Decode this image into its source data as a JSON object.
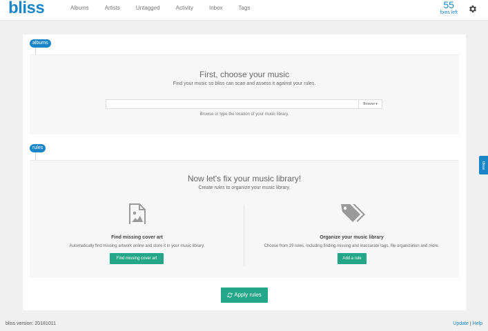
{
  "app": {
    "logo": "bliss",
    "brand_color": "#1a86c8",
    "accent_green": "#26a688"
  },
  "nav": {
    "items": [
      {
        "label": "Albums"
      },
      {
        "label": "Artists"
      },
      {
        "label": "Untagged"
      },
      {
        "label": "Activity"
      },
      {
        "label": "Inbox"
      },
      {
        "label": "Tags"
      }
    ]
  },
  "fixes": {
    "count": "55",
    "label": "fixes left"
  },
  "settings": {
    "icon": "gear-icon"
  },
  "albums": {
    "tag": "albums",
    "title": "First, choose your music",
    "subtitle": "Find your music so bliss can scan and assess it against your rules.",
    "path_value": "",
    "browse_label": "Browse ▾",
    "hint": "Browse or type the location of your music library."
  },
  "rules": {
    "tag": "rules",
    "title": "Now let's fix your music library!",
    "subtitle_pre": "Create ",
    "subtitle_em": "rules",
    "subtitle_post": " to organize your music library.",
    "cover": {
      "icon": "image-file-icon",
      "title": "Find missing cover art",
      "desc": "Automatically find missing artwork online and store it in your music library.",
      "button": "Find missing cover art"
    },
    "organize": {
      "icon": "tags-icon",
      "title": "Organize your music library",
      "desc": "Choose from 19 rules, including finding missing and inaccurate tags, file organization and more.",
      "button": "Add a rule"
    }
  },
  "apply": {
    "icon": "refresh-icon",
    "label": "Apply rules"
  },
  "ideas": {
    "label": "Ideas"
  },
  "footer": {
    "version": "bliss version: 20181011",
    "update": "Update",
    "separator": " | ",
    "help": "Help"
  }
}
